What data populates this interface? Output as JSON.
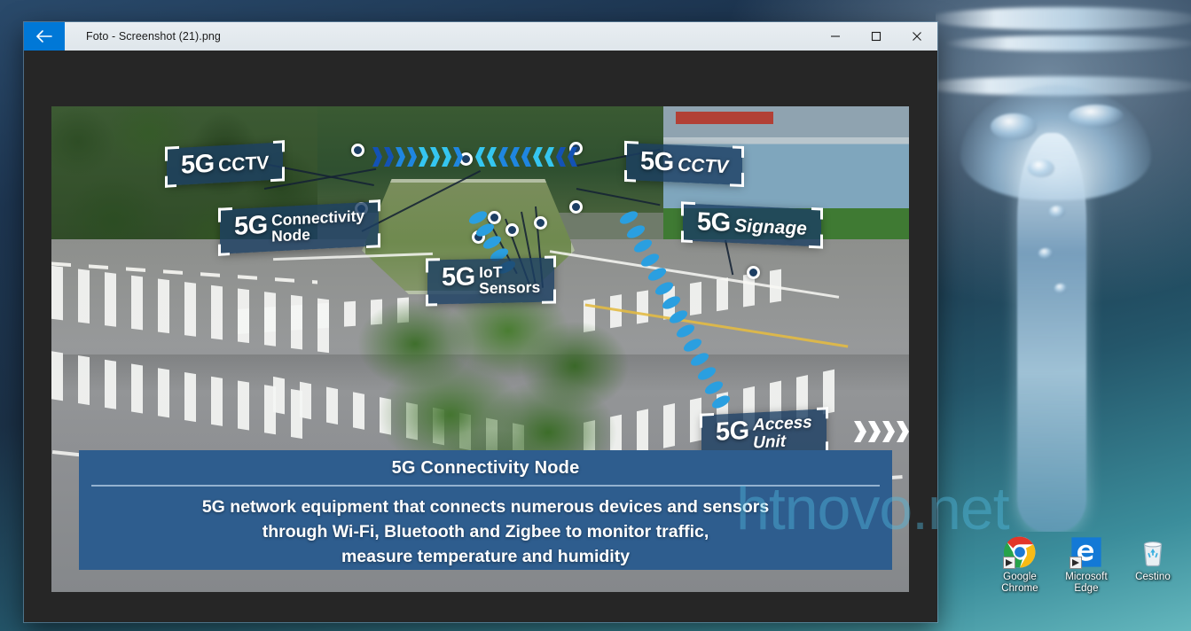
{
  "window": {
    "title": "Foto - Screenshot (21).png",
    "back_icon": "back-arrow-icon",
    "minimize_label": "—",
    "maximize_label": "□",
    "close_label": "✕",
    "accent_color": "#0078d7",
    "titlebar_color": "#e9eef2",
    "viewer_background": "#262626"
  },
  "photo": {
    "tags": [
      {
        "id": "cctv-left",
        "prefix": "5G",
        "name": "CCTV",
        "line1": "",
        "line2": ""
      },
      {
        "id": "conn-node",
        "prefix": "5G",
        "name": "",
        "line1": "Connectivity",
        "line2": "Node"
      },
      {
        "id": "iot",
        "prefix": "5G",
        "name": "",
        "line1": "IoT",
        "line2": "Sensors"
      },
      {
        "id": "cctv-right",
        "prefix": "5G",
        "name": "CCTV",
        "line1": "",
        "line2": ""
      },
      {
        "id": "signage",
        "prefix": "5G",
        "name": "Signage",
        "line1": "",
        "line2": ""
      },
      {
        "id": "access",
        "prefix": "5G",
        "name": "",
        "line1": "Access",
        "line2": "Unit"
      }
    ],
    "caption": {
      "title": "5G Connectivity Node",
      "body_lines": [
        "5G network equipment that connects numerous devices and sensors",
        "through Wi-Fi, Bluetooth and Zigbee to monitor traffic,",
        "measure temperature and humidity"
      ],
      "background_color": "#2e5d8e"
    },
    "watermark": "htnovo.net",
    "signal_color": "#1f86e0",
    "signal_color_light": "#35c6f0"
  },
  "desktop": {
    "icons": [
      {
        "name": "google-chrome",
        "label_line1": "Google",
        "label_line2": "Chrome"
      },
      {
        "name": "microsoft-edge",
        "label_line1": "Microsoft",
        "label_line2": "Edge"
      },
      {
        "name": "recycle-bin",
        "label_line1": "Cestino",
        "label_line2": ""
      }
    ]
  }
}
